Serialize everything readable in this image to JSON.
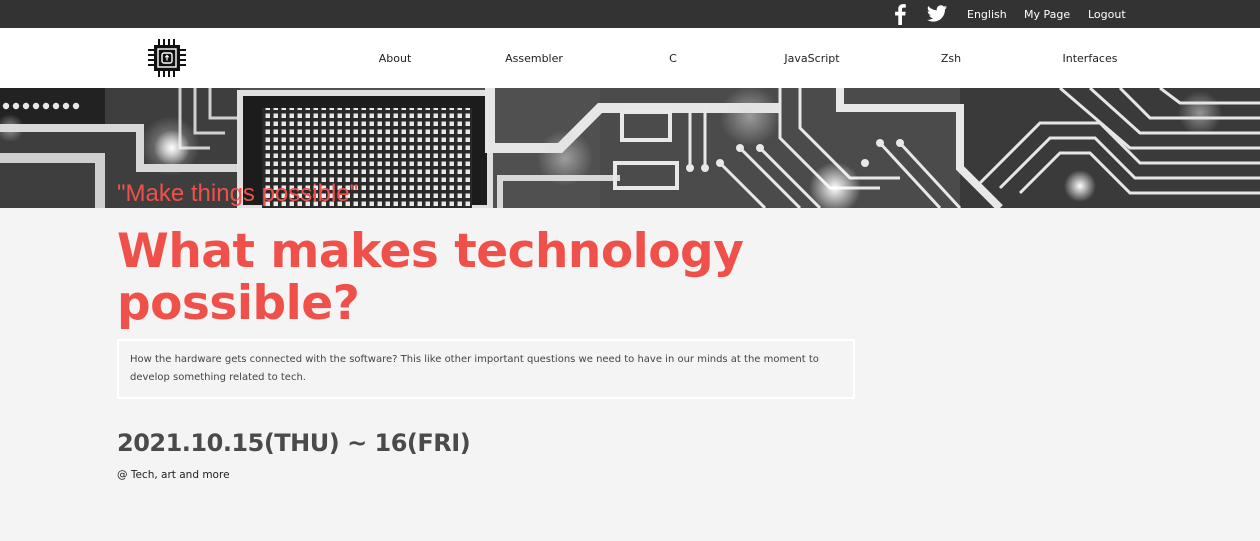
{
  "topbar": {
    "social": [
      "facebook-icon",
      "twitter-icon"
    ],
    "links": {
      "english": "English",
      "mypage": "My Page",
      "logout": "Logout"
    }
  },
  "nav": {
    "logo_icon": "chip-icon",
    "items": [
      "About",
      "Assembler",
      "C",
      "JavaScript",
      "Zsh",
      "Interfaces"
    ]
  },
  "hero": {
    "tagline": "\"Make things possible\""
  },
  "main": {
    "headline": "What makes technology possible?",
    "intro": "How the hardware gets connected with the software? This like other important questions we need to have in our minds at the moment to develop something related to tech.",
    "dates": "2021.10.15(THU) ~ 16(FRI)",
    "venue": "@ Tech, art and more"
  },
  "colors": {
    "accent": "#f0504a",
    "topbar_bg": "#333333",
    "page_bg": "#f4f4f4"
  }
}
